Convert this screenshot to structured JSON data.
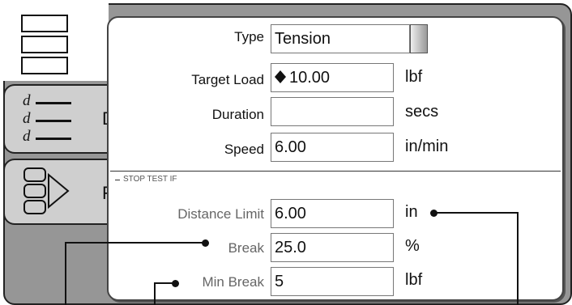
{
  "sidebar": {
    "partial_letter_1": "D",
    "partial_letter_2": "F",
    "d_label": "d"
  },
  "form": {
    "type_label": "Type",
    "type_value": "Tension",
    "target_load_label": "Target Load",
    "target_load_value": "10.00",
    "target_load_unit": "lbf",
    "duration_label": "Duration",
    "duration_value": "",
    "duration_unit": "secs",
    "speed_label": "Speed",
    "speed_value": "6.00",
    "speed_unit": "in/min"
  },
  "stop_test": {
    "section_title": "STOP TEST IF",
    "distance_limit_label": "Distance Limit",
    "distance_limit_value": "6.00",
    "distance_limit_unit": "in",
    "break_label": "Break",
    "break_value": "25.0",
    "break_unit": "%",
    "min_break_label": "Min Break",
    "min_break_value": "5",
    "min_break_unit": "lbf"
  }
}
